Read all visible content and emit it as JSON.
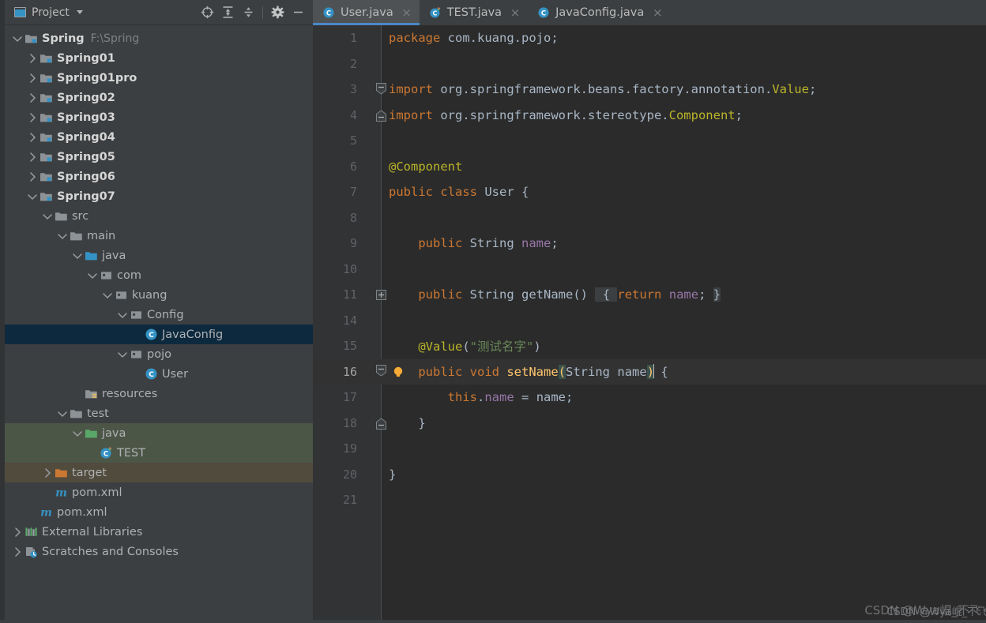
{
  "panel": {
    "title": "Project",
    "window_icon": "project-window-icon",
    "dropdown_icon": "chevron-down-icon",
    "tools": [
      {
        "name": "locate-icon",
        "label": "Select Opened File"
      },
      {
        "name": "expand-all-icon",
        "label": "Expand All"
      },
      {
        "name": "collapse-all-icon",
        "label": "Collapse All"
      },
      {
        "name": "gear-icon",
        "label": "Settings"
      },
      {
        "name": "minimize-icon",
        "label": "Hide"
      }
    ]
  },
  "tree": [
    {
      "label": "Spring",
      "sub": "F:\\Spring",
      "indent": 0,
      "arrow": "down",
      "icon": "module-folder",
      "bold": true,
      "state": "none"
    },
    {
      "label": "Spring01",
      "sub": "",
      "indent": 1,
      "arrow": "right",
      "icon": "module-folder",
      "bold": true,
      "state": "none"
    },
    {
      "label": "Spring01pro",
      "sub": "",
      "indent": 1,
      "arrow": "right",
      "icon": "module-folder",
      "bold": true,
      "state": "none"
    },
    {
      "label": "Spring02",
      "sub": "",
      "indent": 1,
      "arrow": "right",
      "icon": "module-folder",
      "bold": true,
      "state": "none"
    },
    {
      "label": "Spring03",
      "sub": "",
      "indent": 1,
      "arrow": "right",
      "icon": "module-folder",
      "bold": true,
      "state": "none"
    },
    {
      "label": "Spring04",
      "sub": "",
      "indent": 1,
      "arrow": "right",
      "icon": "module-folder",
      "bold": true,
      "state": "none"
    },
    {
      "label": "Spring05",
      "sub": "",
      "indent": 1,
      "arrow": "right",
      "icon": "module-folder",
      "bold": true,
      "state": "none"
    },
    {
      "label": "Spring06",
      "sub": "",
      "indent": 1,
      "arrow": "right",
      "icon": "module-folder",
      "bold": true,
      "state": "none"
    },
    {
      "label": "Spring07",
      "sub": "",
      "indent": 1,
      "arrow": "down",
      "icon": "module-folder",
      "bold": true,
      "state": "none"
    },
    {
      "label": "src",
      "sub": "",
      "indent": 2,
      "arrow": "down",
      "icon": "folder-grey",
      "bold": false,
      "state": "none"
    },
    {
      "label": "main",
      "sub": "",
      "indent": 3,
      "arrow": "down",
      "icon": "folder-grey",
      "bold": false,
      "state": "none"
    },
    {
      "label": "java",
      "sub": "",
      "indent": 4,
      "arrow": "down",
      "icon": "folder-blue",
      "bold": false,
      "state": "none"
    },
    {
      "label": "com",
      "sub": "",
      "indent": 5,
      "arrow": "down",
      "icon": "package",
      "bold": false,
      "state": "none"
    },
    {
      "label": "kuang",
      "sub": "",
      "indent": 6,
      "arrow": "down",
      "icon": "package",
      "bold": false,
      "state": "none"
    },
    {
      "label": "Config",
      "sub": "",
      "indent": 7,
      "arrow": "down",
      "icon": "package",
      "bold": false,
      "state": "none"
    },
    {
      "label": "JavaConfig",
      "sub": "",
      "indent": 8,
      "arrow": "none",
      "icon": "class",
      "bold": false,
      "state": "selected"
    },
    {
      "label": "pojo",
      "sub": "",
      "indent": 7,
      "arrow": "down",
      "icon": "package",
      "bold": false,
      "state": "none"
    },
    {
      "label": "User",
      "sub": "",
      "indent": 8,
      "arrow": "none",
      "icon": "class",
      "bold": false,
      "state": "none"
    },
    {
      "label": "resources",
      "sub": "",
      "indent": 4,
      "arrow": "none",
      "icon": "folder-resources",
      "bold": false,
      "state": "none"
    },
    {
      "label": "test",
      "sub": "",
      "indent": 3,
      "arrow": "down",
      "icon": "folder-grey",
      "bold": false,
      "state": "none"
    },
    {
      "label": "java",
      "sub": "",
      "indent": 4,
      "arrow": "down",
      "icon": "folder-green",
      "bold": false,
      "state": "test-source"
    },
    {
      "label": "TEST",
      "sub": "",
      "indent": 5,
      "arrow": "none",
      "icon": "test-class",
      "bold": false,
      "state": "test-source"
    },
    {
      "label": "target",
      "sub": "",
      "indent": 2,
      "arrow": "right",
      "icon": "folder-orange",
      "bold": false,
      "state": "excluded"
    },
    {
      "label": "pom.xml",
      "sub": "",
      "indent": 2,
      "arrow": "none",
      "icon": "maven",
      "bold": false,
      "state": "none"
    },
    {
      "label": "pom.xml",
      "sub": "",
      "indent": 1,
      "arrow": "none",
      "icon": "maven",
      "bold": false,
      "state": "none"
    },
    {
      "label": "External Libraries",
      "sub": "",
      "indent": 0,
      "arrow": "right",
      "icon": "libraries",
      "bold": false,
      "state": "none"
    },
    {
      "label": "Scratches and Consoles",
      "sub": "",
      "indent": 0,
      "arrow": "right",
      "icon": "scratches",
      "bold": false,
      "state": "none"
    }
  ],
  "tabs": [
    {
      "label": "User.java",
      "icon": "java-class-icon",
      "active": true,
      "close": "×"
    },
    {
      "label": "TEST.java",
      "icon": "java-test-class-icon",
      "active": false,
      "close": "×"
    },
    {
      "label": "JavaConfig.java",
      "icon": "java-class-icon",
      "active": false,
      "close": "×"
    }
  ],
  "editor": {
    "filename": "User.java",
    "caret_line": 16,
    "lines": [
      {
        "num": "1",
        "text": "package com.kuang.pojo;"
      },
      {
        "num": "2",
        "text": ""
      },
      {
        "num": "3",
        "text": "import org.springframework.beans.factory.annotation.Value;"
      },
      {
        "num": "4",
        "text": "import org.springframework.stereotype.Component;"
      },
      {
        "num": "5",
        "text": ""
      },
      {
        "num": "6",
        "text": "@Component"
      },
      {
        "num": "7",
        "text": "public class User {"
      },
      {
        "num": "8",
        "text": ""
      },
      {
        "num": "9",
        "text": "    public String name;"
      },
      {
        "num": "10",
        "text": ""
      },
      {
        "num": "11",
        "text": "    public String getName() { return name; }"
      },
      {
        "num": "14",
        "text": ""
      },
      {
        "num": "15",
        "text": "    @Value(\"测试名字\")"
      },
      {
        "num": "16",
        "text": "    public void setName(String name) {"
      },
      {
        "num": "17",
        "text": "        this.name = name;"
      },
      {
        "num": "18",
        "text": "    }"
      },
      {
        "num": "19",
        "text": ""
      },
      {
        "num": "20",
        "text": "}"
      },
      {
        "num": "21",
        "text": ""
      }
    ]
  },
  "watermark": {
    "text": "CSDN @Wya崐_不飞",
    "overlay": "CSDN @Wya崐_不飞"
  },
  "colors": {
    "panel_bg": "#3c3f41",
    "editor_bg": "#2b2b2b",
    "gutter_bg": "#313335",
    "selection_blue": "#0d293e",
    "test_source_green": "#4c5647",
    "excluded_brown": "#514b3d",
    "accent_blue": "#4a88c7",
    "keyword_orange": "#cc7832",
    "string_green": "#6a8759",
    "annotation_yellow": "#bbb529",
    "field_purple": "#9876aa",
    "method_yellow": "#ffc66d",
    "text_grey": "#a9b7c6"
  }
}
